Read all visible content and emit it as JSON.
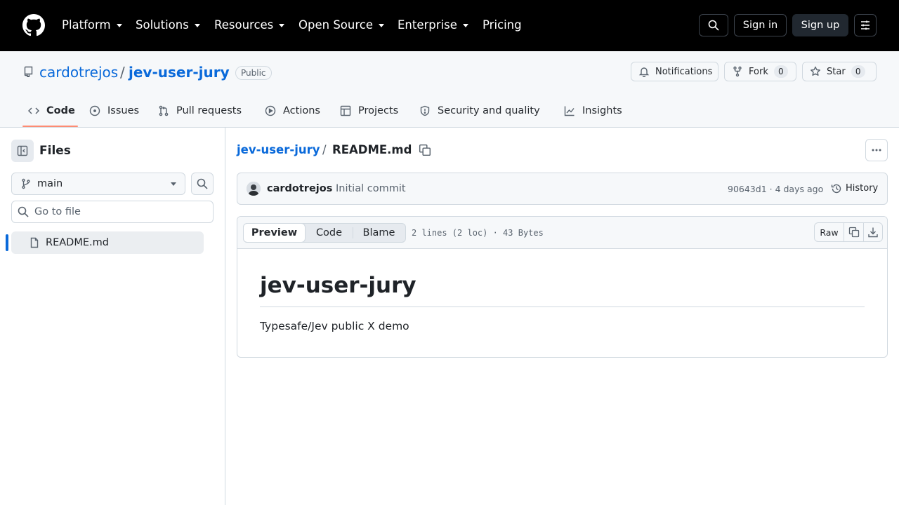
{
  "nav": {
    "items": [
      "Platform",
      "Solutions",
      "Resources",
      "Open Source",
      "Enterprise",
      "Pricing"
    ],
    "sign_in": "Sign in",
    "sign_up": "Sign up",
    "icons": [
      "github-logo-icon",
      "search-icon",
      "filter-icon"
    ]
  },
  "repo": {
    "owner": "cardotrejos",
    "separator": "/",
    "name": "jev-user-jury",
    "visibility": "Public",
    "notifications": "Notifications",
    "fork_label": "Fork",
    "fork_count": "0",
    "star_label": "Star",
    "star_count": "0"
  },
  "tabs": [
    {
      "label": "Code",
      "icon": "code-icon",
      "active": true
    },
    {
      "label": "Issues",
      "icon": "issue-opened-icon"
    },
    {
      "label": "Pull requests",
      "icon": "git-pull-request-icon"
    },
    {
      "label": "Actions",
      "icon": "play-icon"
    },
    {
      "label": "Projects",
      "icon": "table-icon"
    },
    {
      "label": "Security and quality",
      "icon": "shield-icon"
    },
    {
      "label": "Insights",
      "icon": "graph-icon"
    }
  ],
  "sidebar": {
    "title": "Files",
    "branch": "main",
    "goto_placeholder": "Go to file",
    "files": [
      {
        "name": "README.md",
        "selected": true
      }
    ]
  },
  "breadcrumb": {
    "repo": "jev-user-jury",
    "separator": "/",
    "file": "README.md"
  },
  "commit": {
    "author": "cardotrejos",
    "message": "Initial commit",
    "meta": "90643d1 · 4 days ago",
    "history": "History"
  },
  "file": {
    "view_tabs": [
      "Preview",
      "Code",
      "Blame"
    ],
    "active_view": "Preview",
    "info": "2 lines (2 loc) · 43 Bytes",
    "raw": "Raw"
  },
  "readme": {
    "heading": "jev-user-jury",
    "body": "Typesafe/Jev public X demo"
  },
  "colors": {
    "link": "#0969da",
    "tab_underline": "#fd8c73",
    "nav_bg": "#000000"
  }
}
